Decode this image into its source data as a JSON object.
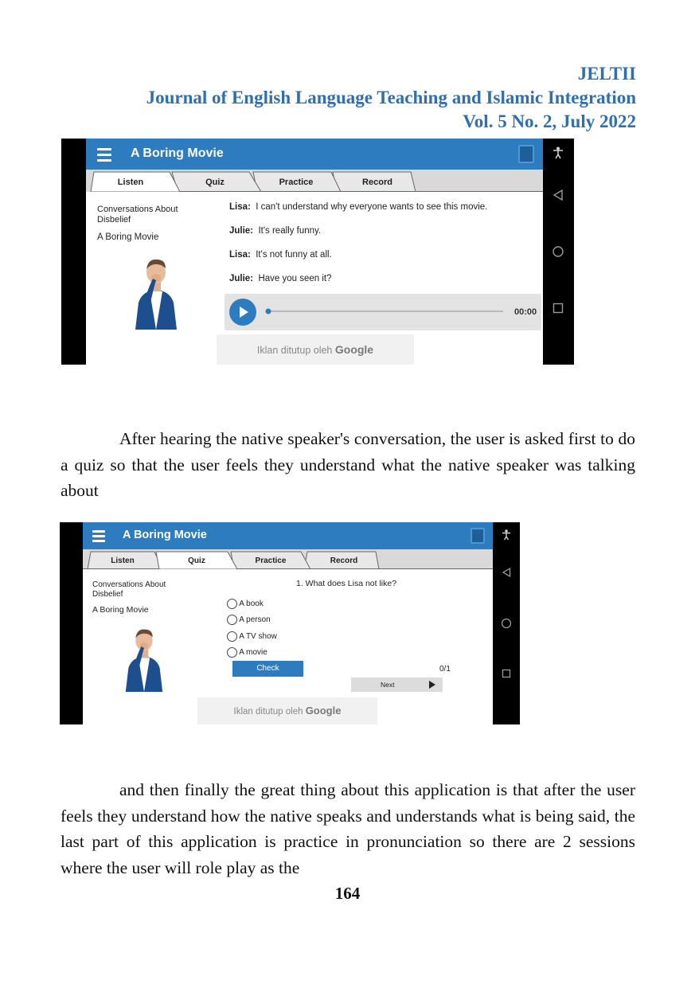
{
  "journal": {
    "abbr": "JELTII",
    "name": "Journal of English Language Teaching and Islamic Integration",
    "volume": "Vol. 5 No. 2, July 2022"
  },
  "screenshot1": {
    "app_title": "A Boring Movie",
    "tabs": [
      "Listen",
      "Quiz",
      "Practice",
      "Record"
    ],
    "active_tab": "Listen",
    "sidebar": {
      "category": "Conversations About Disbelief",
      "lesson": "A Boring Movie"
    },
    "dialog": [
      {
        "speaker": "Lisa:",
        "text": "I can't understand why everyone wants to see this movie."
      },
      {
        "speaker": "Julie:",
        "text": "It's really funny."
      },
      {
        "speaker": "Lisa:",
        "text": "It's not funny at all."
      },
      {
        "speaker": "Julie:",
        "text": "Have you seen it?"
      }
    ],
    "player": {
      "time": "00:00"
    },
    "ad": {
      "text": "Iklan ditutup oleh",
      "brand": "Google"
    }
  },
  "paragraph1": "After hearing the native speaker's conversation, the user is asked first to do a quiz so that the user feels they understand what the native speaker was talking about",
  "screenshot2": {
    "app_title": "A Boring Movie",
    "tabs": [
      "Listen",
      "Quiz",
      "Practice",
      "Record"
    ],
    "active_tab": "Quiz",
    "sidebar": {
      "category": "Conversations About Disbelief",
      "lesson": "A Boring Movie"
    },
    "question": "1. What does Lisa not like?",
    "options": [
      "A book",
      "A person",
      "A TV show",
      "A movie"
    ],
    "check_label": "Check",
    "score": "0/1",
    "next_label": "Next",
    "ad": {
      "text": "Iklan ditutup oleh",
      "brand": "Google"
    }
  },
  "paragraph2": "and then finally the great thing about this application is that after the user feels they understand how the native speaks and understands what is being said, the last part of this application is practice in pronunciation so there are 2 sessions where the user will role play as the",
  "page_number": "164",
  "colors": {
    "accent": "#2d7cc0",
    "header_text": "#2e6fb0"
  }
}
